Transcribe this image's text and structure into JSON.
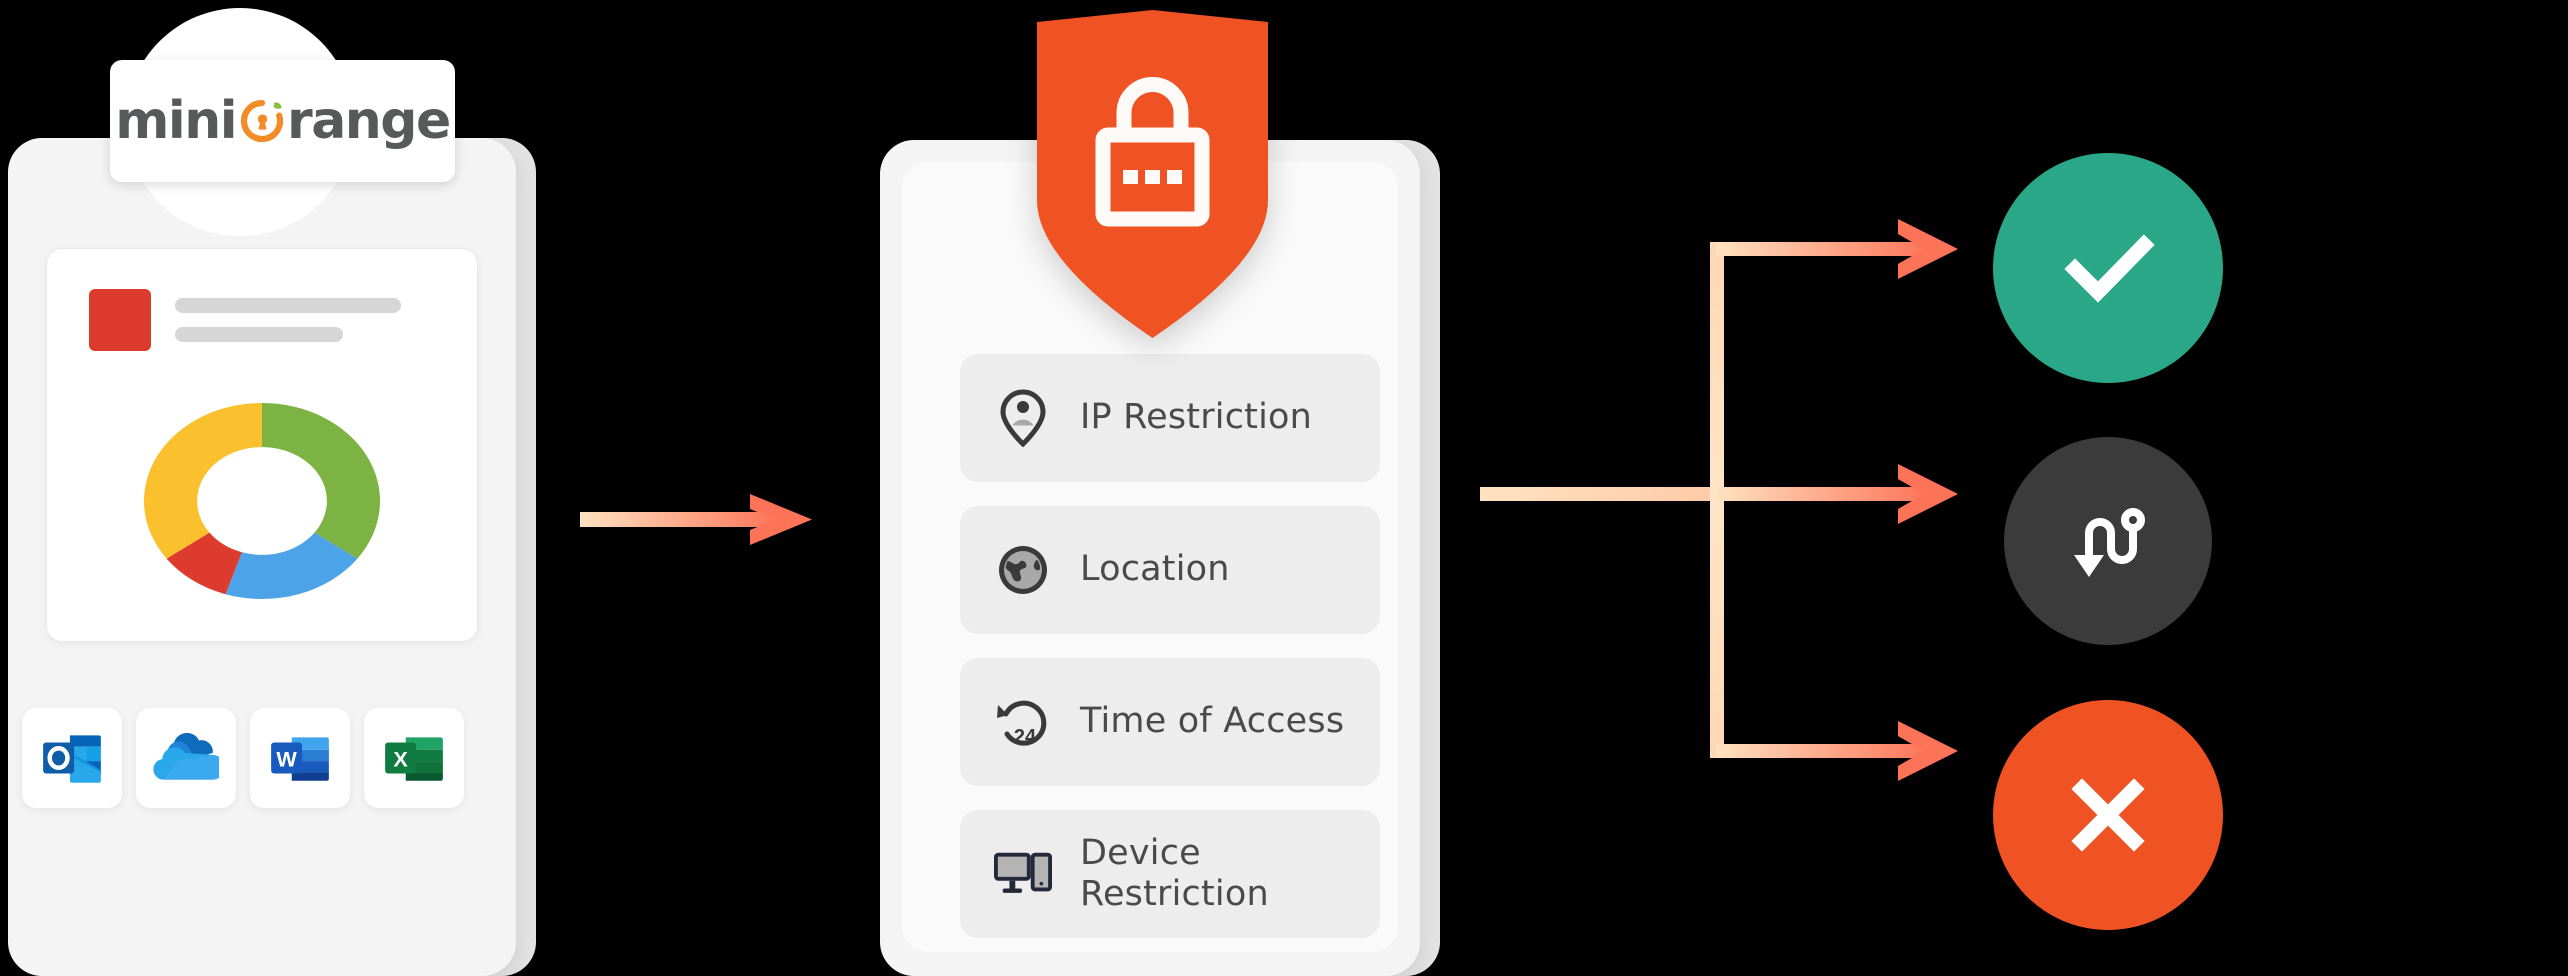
{
  "brand": {
    "logo_part1": "mini",
    "logo_part2": "range",
    "logo_mark": "orange-keyhole-icon",
    "accent_orange": "#f28c28",
    "accent_deep_orange": "#ef5223",
    "text_gray": "#58595b"
  },
  "left_panel": {
    "name": "application-dashboard-clipboard",
    "dashboard_card": {
      "thumbnail_color": "#dd3b2e",
      "placeholder_lines": 2
    },
    "apps": [
      {
        "name": "Outlook",
        "icon": "outlook-icon"
      },
      {
        "name": "OneDrive",
        "icon": "onedrive-icon"
      },
      {
        "name": "Word",
        "icon": "word-icon"
      },
      {
        "name": "Excel",
        "icon": "excel-icon"
      }
    ]
  },
  "chart_data": {
    "type": "pie",
    "title": "",
    "subtitle": "",
    "xlabel": "",
    "ylabel": "",
    "legend_position": "none",
    "grid": false,
    "donut": true,
    "inner_radius_ratio": 0.55,
    "categories": [
      "Green",
      "Blue",
      "Red",
      "Yellow"
    ],
    "values": [
      35,
      20,
      10,
      35
    ],
    "colors": [
      "#7cb342",
      "#4da3e8",
      "#dd3b2e",
      "#fbc02d"
    ],
    "start_angle_deg": 0,
    "annotations": []
  },
  "policy_panel": {
    "name": "access-policy-card",
    "shield_icon": "shield-lock-icon",
    "items": [
      {
        "label": "IP Restriction",
        "icon": "location-pin-person-icon"
      },
      {
        "label": "Location",
        "icon": "globe-icon"
      },
      {
        "label": "Time of Access",
        "icon": "clock-24-hours-icon"
      },
      {
        "label": "Device Restriction",
        "icon": "monitor-tablet-icon"
      }
    ]
  },
  "flow": {
    "arrow_gradient_start": "#ffe2c0",
    "arrow_gradient_end": "#fc7358",
    "arrows": [
      {
        "name": "arrow-apps-to-policy"
      },
      {
        "name": "arrow-policy-to-branch"
      },
      {
        "name": "arrow-branch-allow"
      },
      {
        "name": "arrow-branch-redirect"
      },
      {
        "name": "arrow-branch-deny"
      }
    ]
  },
  "outcomes": [
    {
      "name": "allow",
      "icon": "check-icon",
      "color": "#2aa787"
    },
    {
      "name": "redirect",
      "icon": "redirect-icon",
      "color": "#3b3b3b"
    },
    {
      "name": "deny",
      "icon": "cross-icon",
      "color": "#ef5223"
    }
  ]
}
